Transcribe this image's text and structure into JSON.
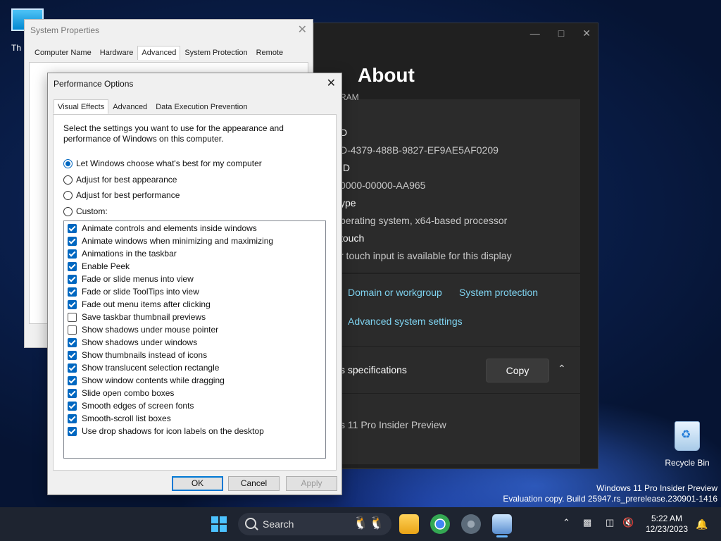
{
  "desktop": {
    "this_pc_label": "Th",
    "recycle_bin_label": "Recycle Bin",
    "watermark_line1": "Windows 11 Pro Insider Preview",
    "watermark_line2": "Evaluation copy. Build 25947.rs_prerelease.230901-1416"
  },
  "about": {
    "heading": "About",
    "specs": [
      {
        "key": "RAM",
        "value": ""
      },
      {
        "key": "D",
        "value": "D-4379-488B-9827-EF9AE5AF0209"
      },
      {
        "key": "ID",
        "value": "0000-00000-AA965"
      },
      {
        "key": "ype",
        "value": "perating system, x64-based processor"
      },
      {
        "key": "touch",
        "value": "r touch input is available for this display"
      }
    ],
    "links": {
      "domain": "Domain or workgroup",
      "protection": "System protection",
      "advanced": "Advanced system settings"
    },
    "specs_header": "s specifications",
    "copy_label": "Copy",
    "edition_text": "s 11 Pro Insider Preview"
  },
  "sysprops": {
    "title": "System Properties",
    "tabs": [
      "Computer Name",
      "Hardware",
      "Advanced",
      "System Protection",
      "Remote"
    ],
    "active_tab": "Advanced"
  },
  "perf": {
    "title": "Performance Options",
    "tabs": [
      "Visual Effects",
      "Advanced",
      "Data Execution Prevention"
    ],
    "active_tab": "Visual Effects",
    "intro": "Select the settings you want to use for the appearance and performance of Windows on this computer.",
    "radios": [
      {
        "label": "Let Windows choose what's best for my computer",
        "checked": true
      },
      {
        "label": "Adjust for best appearance",
        "checked": false
      },
      {
        "label": "Adjust for best performance",
        "checked": false
      },
      {
        "label": "Custom:",
        "checked": false
      }
    ],
    "checkboxes": [
      {
        "label": "Animate controls and elements inside windows",
        "checked": true
      },
      {
        "label": "Animate windows when minimizing and maximizing",
        "checked": true
      },
      {
        "label": "Animations in the taskbar",
        "checked": true
      },
      {
        "label": "Enable Peek",
        "checked": true
      },
      {
        "label": "Fade or slide menus into view",
        "checked": true
      },
      {
        "label": "Fade or slide ToolTips into view",
        "checked": true
      },
      {
        "label": "Fade out menu items after clicking",
        "checked": true
      },
      {
        "label": "Save taskbar thumbnail previews",
        "checked": false
      },
      {
        "label": "Show shadows under mouse pointer",
        "checked": false
      },
      {
        "label": "Show shadows under windows",
        "checked": true
      },
      {
        "label": "Show thumbnails instead of icons",
        "checked": true
      },
      {
        "label": "Show translucent selection rectangle",
        "checked": true
      },
      {
        "label": "Show window contents while dragging",
        "checked": true
      },
      {
        "label": "Slide open combo boxes",
        "checked": true
      },
      {
        "label": "Smooth edges of screen fonts",
        "checked": true
      },
      {
        "label": "Smooth-scroll list boxes",
        "checked": true
      },
      {
        "label": "Use drop shadows for icon labels on the desktop",
        "checked": true
      }
    ],
    "buttons": {
      "ok": "OK",
      "cancel": "Cancel",
      "apply": "Apply"
    }
  },
  "taskbar": {
    "search_label": "Search",
    "time": "5:22 AM",
    "date": "12/23/2023"
  },
  "colors": {
    "accent": "#0067c0",
    "link": "#7fd3f0",
    "dark_bg": "#202020"
  }
}
